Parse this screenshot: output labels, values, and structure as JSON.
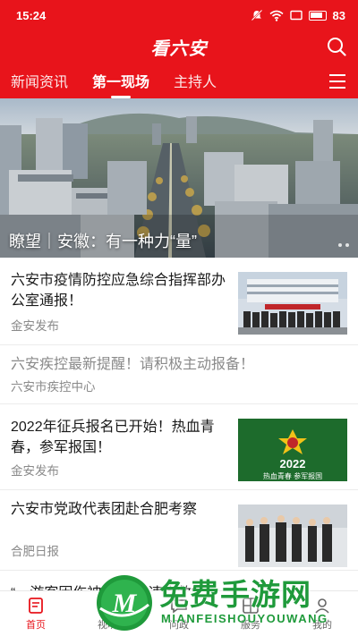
{
  "status_bar": {
    "time": "15:24",
    "battery": "83"
  },
  "app": {
    "title": "看六安"
  },
  "tabs": [
    {
      "label": "新闻资讯",
      "active": false
    },
    {
      "label": "第一现场",
      "active": true
    },
    {
      "label": "主持人",
      "active": false
    }
  ],
  "hero": {
    "caption": "瞭望｜安徽：有一种力“量”"
  },
  "news": [
    {
      "title": "六安市疫情防控应急综合指挥部办公室通报！",
      "source": "金安发布",
      "has_thumb": true
    },
    {
      "title": "六安疾控最新提醒！请积极主动报备！",
      "source": "六安市疾控中心",
      "has_thumb": false,
      "read": true
    },
    {
      "title": "2022年征兵报名已开始！热血青春，参军报国！",
      "source": "金安发布",
      "has_thumb": true,
      "thumb_text": "2022",
      "thumb_banner": "热血青春 参军报国"
    },
    {
      "title": "六安市党政代表团赴合肥考察",
      "source": "合肥日报",
      "has_thumb": true
    },
    {
      "title": "“一游客因伤被困山中 速度救援",
      "source": "",
      "has_thumb": false
    }
  ],
  "bottom_nav": [
    {
      "label": "首页",
      "icon": "home-icon",
      "active": true
    },
    {
      "label": "视听",
      "icon": "tv-icon",
      "active": false
    },
    {
      "label": "问政",
      "icon": "chat-icon",
      "active": false
    },
    {
      "label": "服务",
      "icon": "grid-icon",
      "active": false
    },
    {
      "label": "我的",
      "icon": "user-icon",
      "active": false
    }
  ],
  "watermark": {
    "title": "免费手游网",
    "subtitle": "MIANFEISHOUYOUWANG",
    "logo_letter": "M"
  },
  "colors": {
    "brand_red": "#e8141b",
    "watermark_green": "#1f9a3b"
  }
}
